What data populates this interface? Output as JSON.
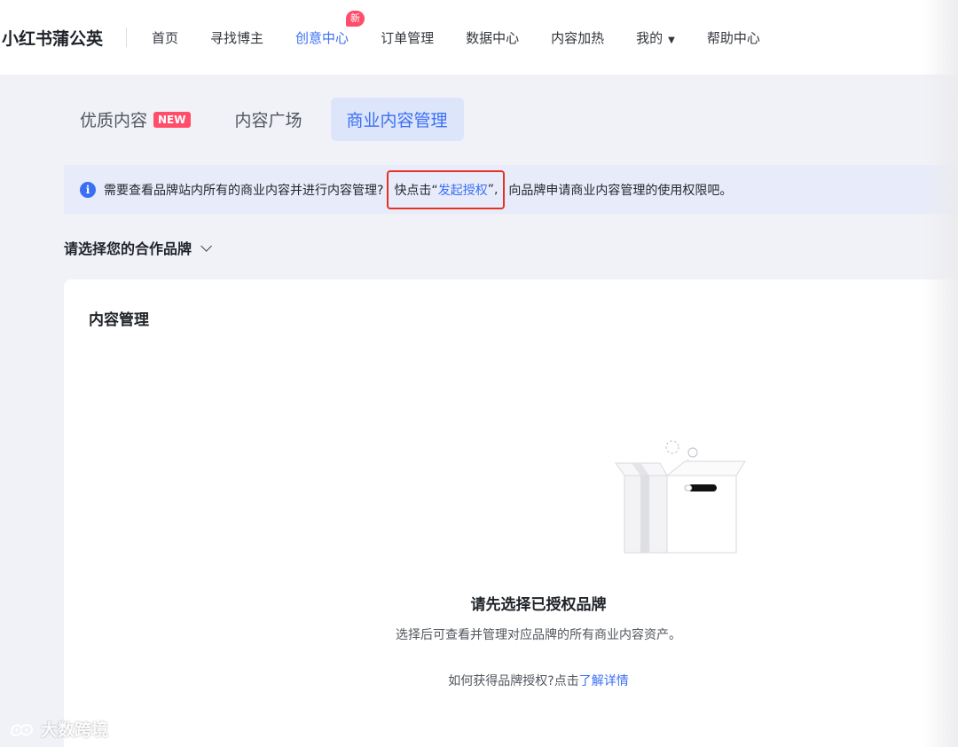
{
  "header": {
    "brand": "小红书蒲公英",
    "nav": [
      {
        "label": "首页",
        "active": false
      },
      {
        "label": "寻找博主",
        "active": false
      },
      {
        "label": "创意中心",
        "active": true,
        "badge": "新"
      },
      {
        "label": "订单管理",
        "active": false
      },
      {
        "label": "数据中心",
        "active": false
      },
      {
        "label": "内容加热",
        "active": false
      },
      {
        "label": "我的",
        "active": false,
        "dropdown": true
      },
      {
        "label": "帮助中心",
        "active": false
      }
    ]
  },
  "tabs": [
    {
      "label": "优质内容",
      "badge": "NEW",
      "active": false
    },
    {
      "label": "内容广场",
      "active": false
    },
    {
      "label": "商业内容管理",
      "active": true
    }
  ],
  "notice": {
    "prefix": "需要查看品牌站内所有的商业内容并进行内容管理?",
    "cta_prefix": "快点击“",
    "cta_link": "发起授权",
    "cta_suffix": "”,",
    "suffix": "向品牌申请商业内容管理的使用权限吧。"
  },
  "brand_select": {
    "label": "请选择您的合作品牌"
  },
  "content": {
    "title": "内容管理",
    "empty_title": "请先选择已授权品牌",
    "empty_desc": "选择后可查看并管理对应品牌的所有商业内容资产。",
    "help_prefix": "如何获得品牌授权?点击",
    "help_link": "了解详情"
  },
  "watermark": "大数跨境",
  "colors": {
    "accent": "#3a6ff5",
    "badge": "#ff4d6a",
    "highlight_border": "#e53322",
    "notice_bg": "#e8ecfa",
    "page_bg": "#f1f2f7"
  }
}
